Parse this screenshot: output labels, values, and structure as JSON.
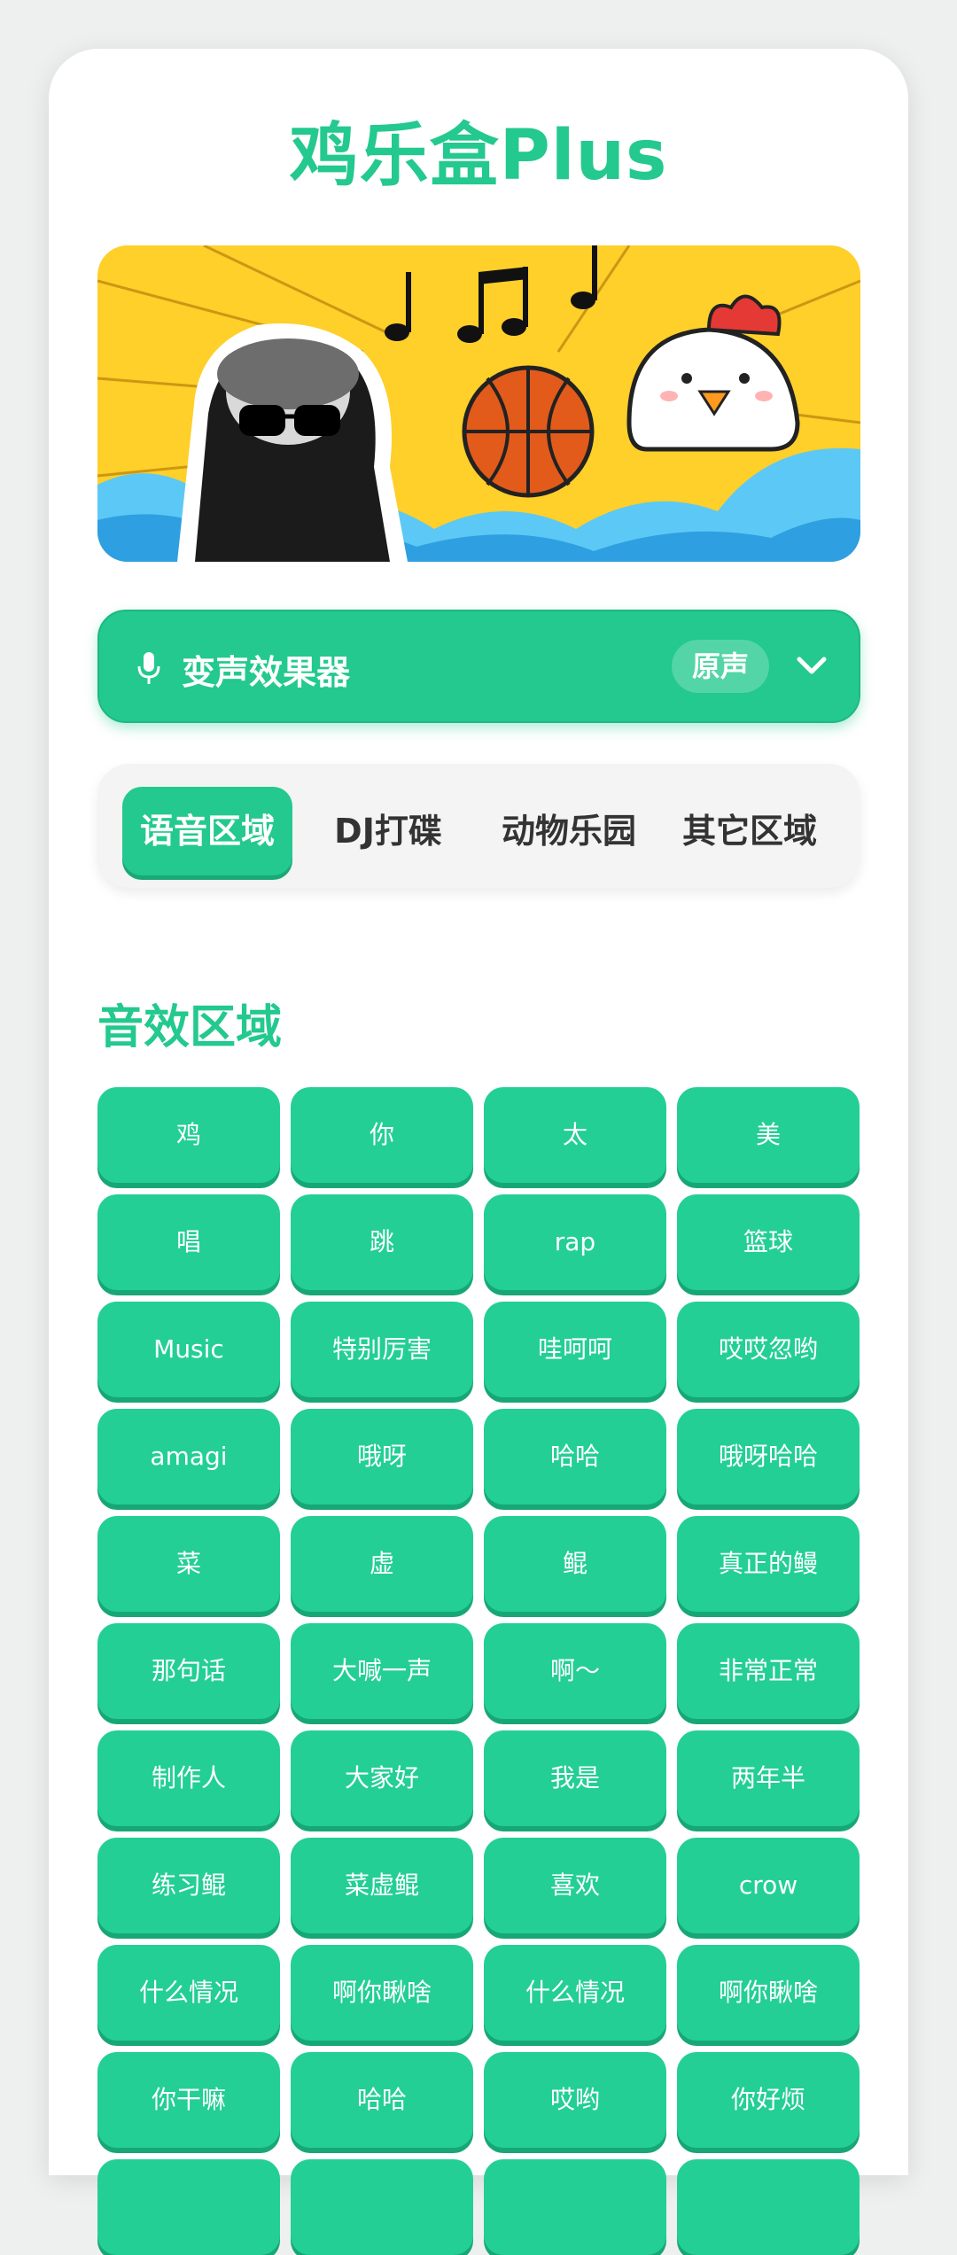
{
  "app": {
    "title": "鸡乐盒Plus"
  },
  "banner": {
    "description": "cartoon banner: panda meme, music notes, basketball, chick",
    "bg_color": "#ffcf2a"
  },
  "voice_changer": {
    "icon": "microphone-icon",
    "label": "变声效果器",
    "current": "原声",
    "toggle_icon": "chevron-down-icon"
  },
  "tabs": [
    {
      "label": "语音区域",
      "active": true
    },
    {
      "label": "DJ打碟",
      "active": false
    },
    {
      "label": "动物乐园",
      "active": false
    },
    {
      "label": "其它区域",
      "active": false
    }
  ],
  "section": {
    "title": "音效区域"
  },
  "sound_buttons": [
    "鸡",
    "你",
    "太",
    "美",
    "唱",
    "跳",
    "rap",
    "篮球",
    "Music",
    "特别厉害",
    "哇呵呵",
    "哎哎忽哟",
    "amagi",
    "哦呀",
    "哈哈",
    "哦呀哈哈",
    "菜",
    "虚",
    "鲲",
    "真正的鳗",
    "那句话",
    "大喊一声",
    "啊～",
    "非常正常",
    "制作人",
    "大家好",
    "我是",
    "两年半",
    "练习鲲",
    "菜虚鲲",
    "喜欢",
    "crow",
    "什么情况",
    "啊你瞅啥",
    "什么情况",
    "啊你瞅啥",
    "你干嘛",
    "哈哈",
    "哎哟",
    "你好烦"
  ],
  "colors": {
    "accent": "#23c98f",
    "button": "#23cf94",
    "button_shadow": "#17a777"
  }
}
